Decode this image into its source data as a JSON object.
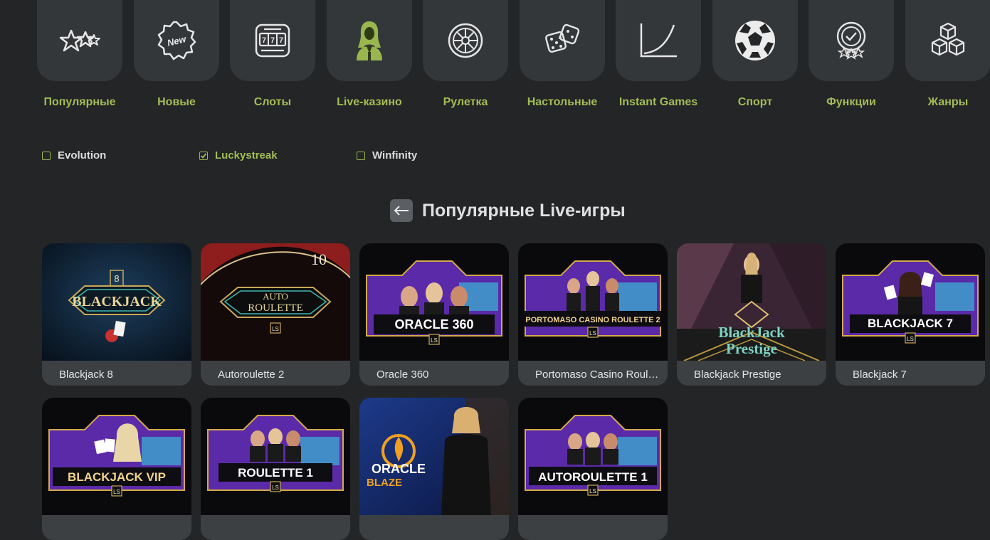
{
  "categories": [
    {
      "label": "Популярные",
      "icon": "stars-icon"
    },
    {
      "label": "Новые",
      "icon": "new-badge-icon"
    },
    {
      "label": "Слоты",
      "icon": "slot-machine-icon"
    },
    {
      "label": "Live-казино",
      "icon": "live-dealer-icon",
      "active": true
    },
    {
      "label": "Рулетка",
      "icon": "roulette-icon"
    },
    {
      "label": "Настольные",
      "icon": "dice-icon"
    },
    {
      "label": "Instant Games",
      "icon": "crash-graph-icon"
    },
    {
      "label": "Спорт",
      "icon": "soccer-ball-icon"
    },
    {
      "label": "Функции",
      "icon": "award-badge-icon"
    },
    {
      "label": "Жанры",
      "icon": "cubes-icon"
    }
  ],
  "filters": [
    {
      "label": "Evolution",
      "checked": false
    },
    {
      "label": "Luckystreak",
      "checked": true
    },
    {
      "label": "Winfinity",
      "checked": false
    }
  ],
  "section": {
    "title": "Популярные Live-игры",
    "back_icon": "arrow-left-icon"
  },
  "games": [
    {
      "name": "Blackjack 8",
      "logo": "BLACKJACK",
      "badge": "8"
    },
    {
      "name": "Autoroulette 2",
      "logo": "AUTO",
      "logo2": "ROULETTE",
      "badge": "LS"
    },
    {
      "name": "Oracle 360",
      "logo": "ORACLE 360",
      "badge": "LS"
    },
    {
      "name": "Portomaso Casino Roulette 2",
      "logo": "PORTOMASO CASINO ROULETTE 2",
      "badge": "LS"
    },
    {
      "name": "Blackjack Prestige",
      "logo": "BlackJack",
      "logo2": "Prestige"
    },
    {
      "name": "Blackjack 7",
      "logo": "BLACKJACK 7",
      "badge": "LS"
    },
    {
      "name": "Blackjack VIP",
      "logo": "BLACKJACK VIP",
      "badge": "LS"
    },
    {
      "name": "Roulette 1",
      "logo": "ROULETTE 1",
      "badge": "LS"
    },
    {
      "name": "Oracle Blaze",
      "logo": "ORACLE",
      "logo2": "BLAZE"
    },
    {
      "name": "Autoroulette 1",
      "logo": "AUTOROULETTE 1",
      "badge": "LS"
    }
  ],
  "colors": {
    "background": "#232527",
    "tile": "#34373a",
    "accent": "#a3bd55",
    "card_footer": "#3d4043",
    "purple": "#6a2bb5"
  }
}
